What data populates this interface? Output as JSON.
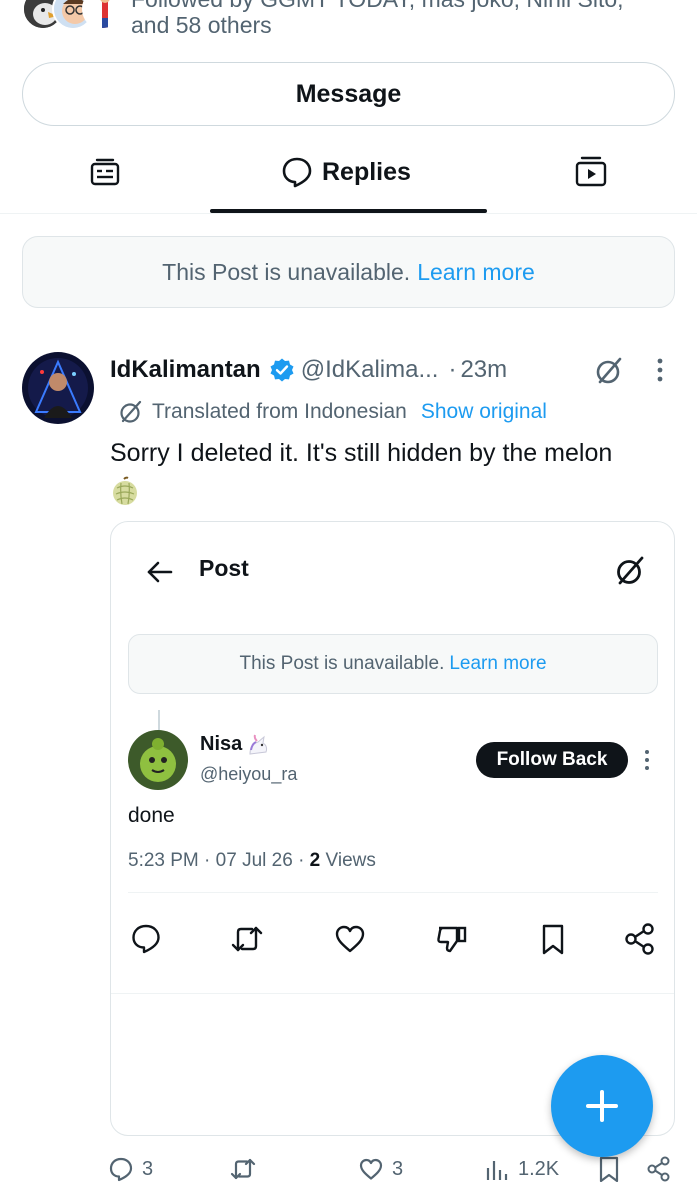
{
  "followed_by": {
    "line1": "Followed by GGMT TODAY, mas joko, Nihil Sito,",
    "line2": "and 58 others"
  },
  "message_button": "Message",
  "tabs": {
    "left_icon": "article-icon",
    "center_label": "Replies",
    "center_icon": "speech-bubble-icon",
    "right_icon": "video-icon"
  },
  "unavailable_notice": {
    "text": "This Post is unavailable.",
    "link": "Learn more"
  },
  "post": {
    "display_name": "IdKalimantan",
    "handle": "@IdKalima...",
    "separator": "·",
    "time": "23m",
    "translated_label": "Translated from Indonesian",
    "show_original": "Show original",
    "text": "Sorry I deleted it. It's still hidden by the melon",
    "emoji": "melon"
  },
  "embedded_card": {
    "title": "Post",
    "unavailable_text": "This Post is unavailable.",
    "unavailable_link": "Learn more",
    "reply": {
      "name": "Nisa",
      "name_emoji": "unicorn",
      "handle": "@heiyou_ra",
      "follow_back": "Follow Back",
      "text": "done",
      "time": "5:23 PM",
      "date": "07 Jul 26",
      "views_count": "2",
      "views_label": "Views"
    }
  },
  "bottom_actions": {
    "replies": "3",
    "likes": "3",
    "views": "1.2K"
  },
  "colors": {
    "accent": "#1d9bf0",
    "text_primary": "#0f1419",
    "text_secondary": "#536471",
    "verified": "#1d9bf0"
  }
}
